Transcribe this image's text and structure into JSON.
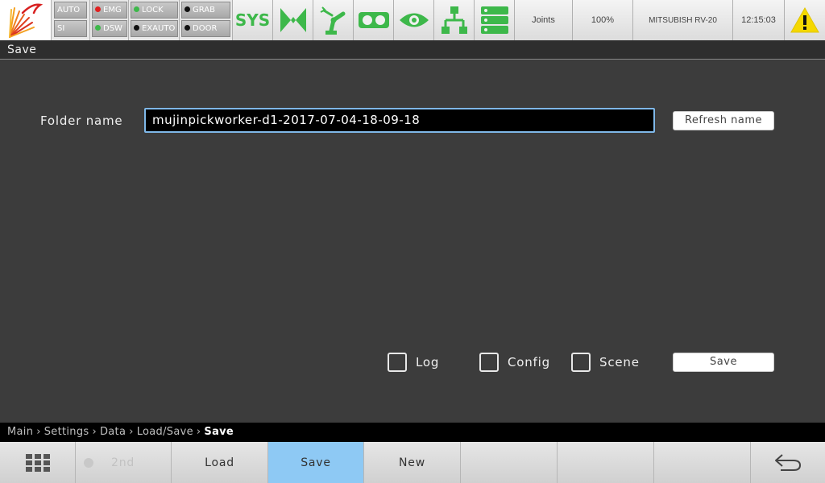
{
  "topbar": {
    "status_col1": [
      "AUTO",
      "SI"
    ],
    "status_col2": [
      {
        "label": "EMG",
        "dot": "#e02020"
      },
      {
        "label": "DSW",
        "dot": "#3db84a"
      }
    ],
    "status_col3": [
      {
        "label": "LOCK",
        "dot": "#3db84a"
      },
      {
        "label": "EXAUTO",
        "dot": "#111111"
      }
    ],
    "status_col4": [
      {
        "label": "GRAB",
        "dot": "#111111"
      },
      {
        "label": "DOOR",
        "dot": "#111111"
      }
    ],
    "sys_label": "SYS",
    "mode": "Joints",
    "speed": "100%",
    "robot": "MITSUBISH RV-20",
    "clock": "12:15:03",
    "accent_green": "#3db84a",
    "warning_color": "#f5d800"
  },
  "page": {
    "title": "Save"
  },
  "form": {
    "folder_label": "Folder name",
    "folder_value": "mujinpickworker-d1-2017-07-04-18-09-18",
    "refresh_label": "Refresh name",
    "options": [
      {
        "label": "Log",
        "checked": false
      },
      {
        "label": "Config",
        "checked": false
      },
      {
        "label": "Scene",
        "checked": false
      }
    ],
    "save_label": "Save"
  },
  "breadcrumb": {
    "items": [
      "Main",
      "Settings",
      "Data",
      "Load/Save"
    ],
    "current": "Save",
    "separator": "›"
  },
  "bottombar": {
    "second_label": "2nd",
    "buttons": [
      "Load",
      "Save",
      "New"
    ],
    "active": "Save",
    "active_color": "#8ec9f4"
  }
}
